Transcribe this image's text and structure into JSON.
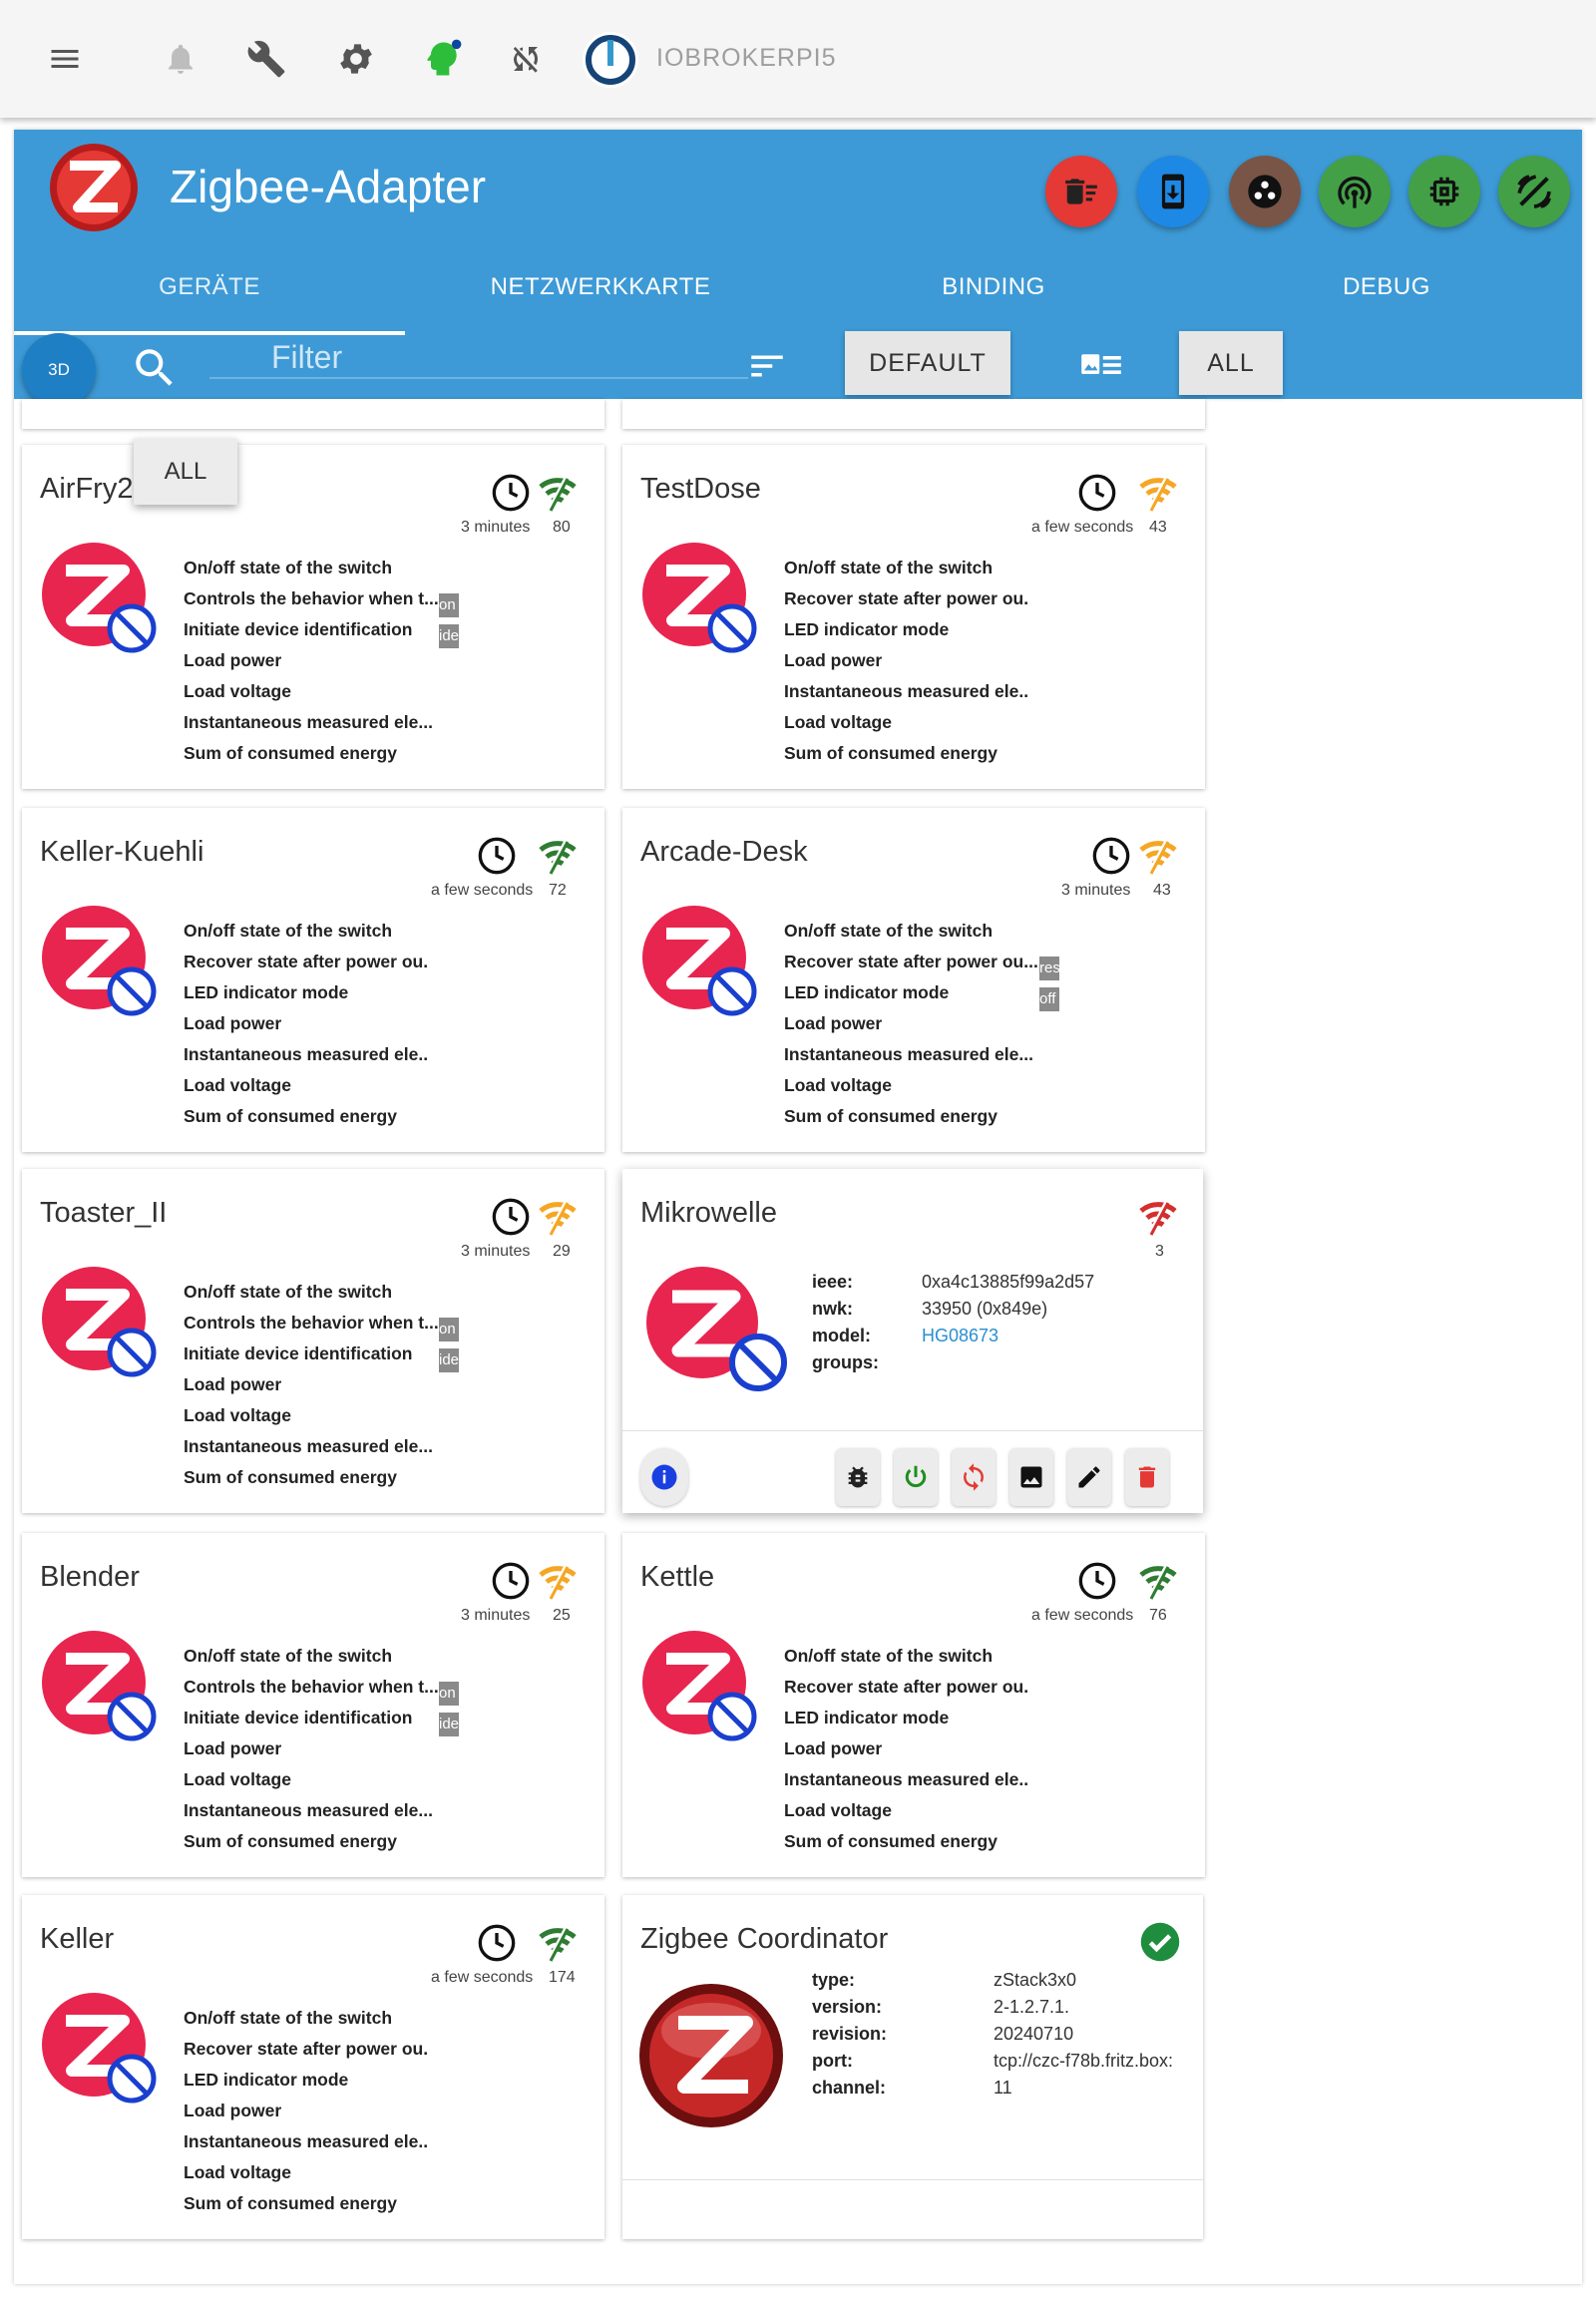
{
  "topbar": {
    "host": "IOBROKERPI5",
    "icons": [
      "menu-icon",
      "bell-icon",
      "wrench-icon",
      "gear-icon",
      "user-head-icon",
      "sync-off-icon",
      "iobroker-logo"
    ]
  },
  "adapter": {
    "title": "Zigbee-Adapter",
    "tabs": [
      "GERÄTE",
      "NETZWERKKARTE",
      "BINDING",
      "DEBUG"
    ],
    "filter_placeholder": "Filter",
    "btn_3d": "3D",
    "default_label": "DEFAULT",
    "all_label": "ALL",
    "popup_all": "ALL",
    "header_buttons": [
      {
        "icon": "delete-sweep-icon",
        "color": "#e53935"
      },
      {
        "icon": "phone-download-icon",
        "color": "#1e88e5"
      },
      {
        "icon": "groups-icon",
        "color": "#795548"
      },
      {
        "icon": "wifi-tethering-icon",
        "color": "#43a047"
      },
      {
        "icon": "chip-icon",
        "color": "#43a047"
      },
      {
        "icon": "signal-cellular-icon",
        "color": "#43a047"
      }
    ]
  },
  "colors": {
    "header": "#3d9ad6",
    "good": "#2e7d32",
    "warn": "#f5a623",
    "bad": "#d32f2f",
    "zred": "#e8254f"
  },
  "devices": [
    {
      "name": "AirFry2",
      "time": "3 minutes",
      "lq": "80",
      "states": [
        "On/off state of the switch",
        "Controls the behavior when t...",
        "Initiate device identification",
        "Load power",
        "Load voltage",
        "Instantaneous measured ele...",
        "Sum of consumed energy"
      ],
      "tags": [
        "on",
        "ide"
      ]
    },
    {
      "name": "TestDose",
      "time": "a few seconds",
      "lq": "43",
      "states": [
        "On/off state of the switch",
        "Recover state after power ou.",
        "LED indicator mode",
        "Load power",
        "Instantaneous measured ele..",
        "Load voltage",
        "Sum of consumed energy"
      ]
    },
    {
      "name": "Keller-Kuehli",
      "time": "a few seconds",
      "lq": "72",
      "states": [
        "On/off state of the switch",
        "Recover state after power ou.",
        "LED indicator mode",
        "Load power",
        "Instantaneous measured ele..",
        "Load voltage",
        "Sum of consumed energy"
      ]
    },
    {
      "name": "Arcade-Desk",
      "time": "3 minutes",
      "lq": "43",
      "states": [
        "On/off state of the switch",
        "Recover state after power ou...",
        "LED indicator mode",
        "Load power",
        "Instantaneous measured ele...",
        "Load voltage",
        "Sum of consumed energy"
      ],
      "tags": [
        "res",
        "off"
      ]
    },
    {
      "name": "Toaster_II",
      "time": "3 minutes",
      "lq": "29",
      "states": [
        "On/off state of the switch",
        "Controls the behavior when t...",
        "Initiate device identification",
        "Load power",
        "Load voltage",
        "Instantaneous measured ele...",
        "Sum of consumed energy"
      ],
      "tags": [
        "on",
        "ide"
      ]
    },
    {
      "name": "Blender",
      "time": "3 minutes",
      "lq": "25",
      "states": [
        "On/off state of the switch",
        "Controls the behavior when t...",
        "Initiate device identification",
        "Load power",
        "Load voltage",
        "Instantaneous measured ele...",
        "Sum of consumed energy"
      ],
      "tags": [
        "on",
        "ide"
      ]
    },
    {
      "name": "Kettle",
      "time": "a few seconds",
      "lq": "76",
      "states": [
        "On/off state of the switch",
        "Recover state after power ou.",
        "LED indicator mode",
        "Load power",
        "Instantaneous measured ele..",
        "Load voltage",
        "Sum of consumed energy"
      ]
    },
    {
      "name": "Keller",
      "time": "a few seconds",
      "lq": "174",
      "states": [
        "On/off state of the switch",
        "Recover state after power ou.",
        "LED indicator mode",
        "Load power",
        "Instantaneous measured ele..",
        "Load voltage",
        "Sum of consumed energy"
      ]
    }
  ],
  "mikrowelle": {
    "name": "Mikrowelle",
    "lq": "3",
    "keys": [
      "ieee:",
      "nwk:",
      "model:",
      "groups:"
    ],
    "values": [
      "0xa4c13885f99a2d57",
      "33950 (0x849e)",
      "HG08673",
      ""
    ]
  },
  "coordinator": {
    "name": "Zigbee Coordinator",
    "keys": [
      "type:",
      "version:",
      "revision:",
      "port:",
      "channel:"
    ],
    "values": [
      "zStack3x0",
      "2-1.2.7.1.",
      "20240710",
      "tcp://czc-f78b.fritz.box:",
      "11"
    ]
  }
}
